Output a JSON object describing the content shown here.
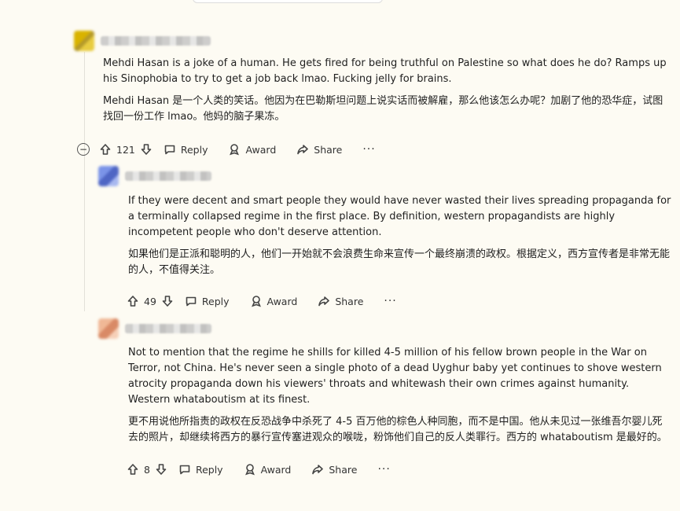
{
  "comments": [
    {
      "text_en": "Mehdi Hasan is a joke of a human. He gets fired for being truthful on Palestine so what does he do? Ramps up his Sinophobia to try to get a job back lmao. Fucking jelly for brains.",
      "text_cn": "Mehdi Hasan 是一个人类的笑话。他因为在巴勒斯坦问题上说实话而被解雇，那么他该怎么办呢？加剧了他的恐华症，试图找回一份工作 lmao。他妈的脑子果冻。",
      "votes": "121",
      "reply_label": "Reply",
      "award_label": "Award",
      "share_label": "Share",
      "more_label": "···",
      "collapse_symbol": "−"
    },
    {
      "text_en": "If they were decent and smart people they would have never wasted their lives spreading propaganda for a terminally collapsed regime in the first place. By definition, western propagandists are highly incompetent people who don't deserve attention.",
      "text_cn": "如果他们是正派和聪明的人，他们一开始就不会浪费生命来宣传一个最终崩溃的政权。根据定义，西方宣传者是非常无能的人，不值得关注。",
      "votes": "49",
      "reply_label": "Reply",
      "award_label": "Award",
      "share_label": "Share",
      "more_label": "···"
    },
    {
      "text_en": "Not to mention that the regime he shills for killed 4-5 million of his fellow brown people in the War on Terror, not China. He's never seen a single photo of a dead Uyghur baby yet continues to shove western atrocity propaganda down his viewers' throats and whitewash their own crimes against humanity. Western whataboutism at its finest.",
      "text_cn": "更不用说他所指责的政权在反恐战争中杀死了 4-5 百万他的棕色人种同胞，而不是中国。他从未见过一张维吾尔婴儿死去的照片，却继续将西方的暴行宣传塞进观众的喉咙，粉饰他们自己的反人类罪行。西方的 whataboutism 是最好的。",
      "votes": "8",
      "reply_label": "Reply",
      "award_label": "Award",
      "share_label": "Share",
      "more_label": "···"
    }
  ]
}
